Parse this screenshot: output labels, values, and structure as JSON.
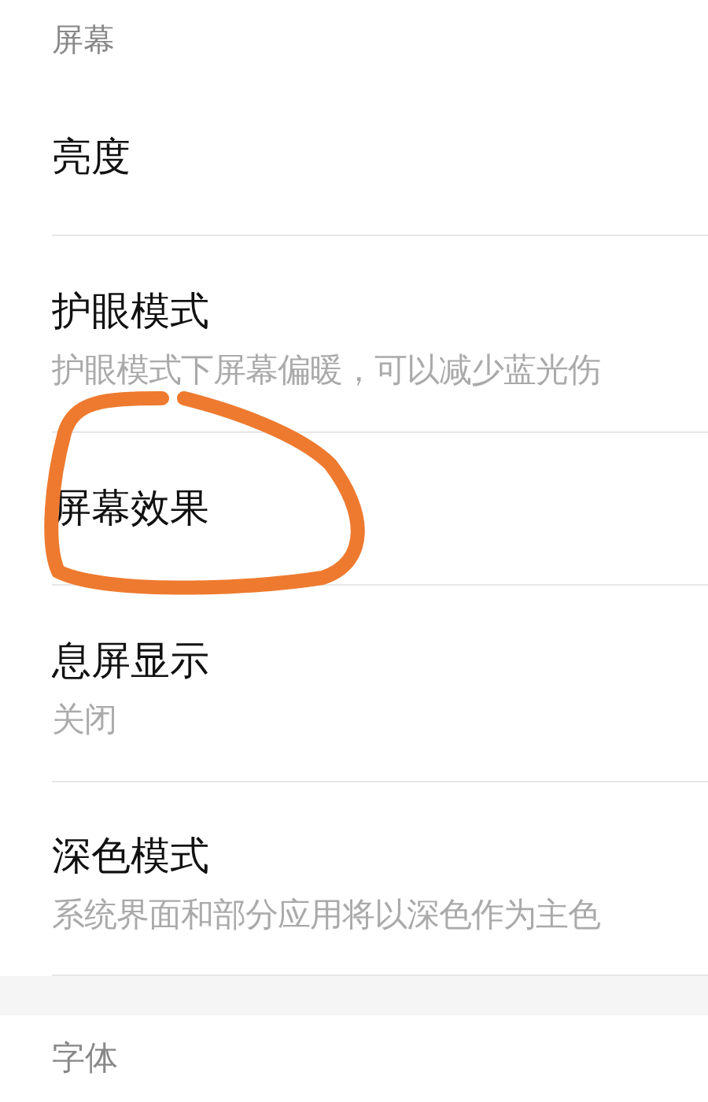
{
  "section_header": "屏幕",
  "items": [
    {
      "title": "亮度",
      "circled": false
    },
    {
      "title": "护眼模式",
      "subtitle": "护眼模式下屏幕偏暖，可以减少蓝光伤",
      "circled": false
    },
    {
      "title": "屏幕效果",
      "circled": true
    },
    {
      "title": "息屏显示",
      "subtitle": "关闭",
      "circled": false
    },
    {
      "title": "深色模式",
      "subtitle": "系统界面和部分应用将以深色作为主色",
      "circled": false
    }
  ],
  "next_section_header": "字体"
}
